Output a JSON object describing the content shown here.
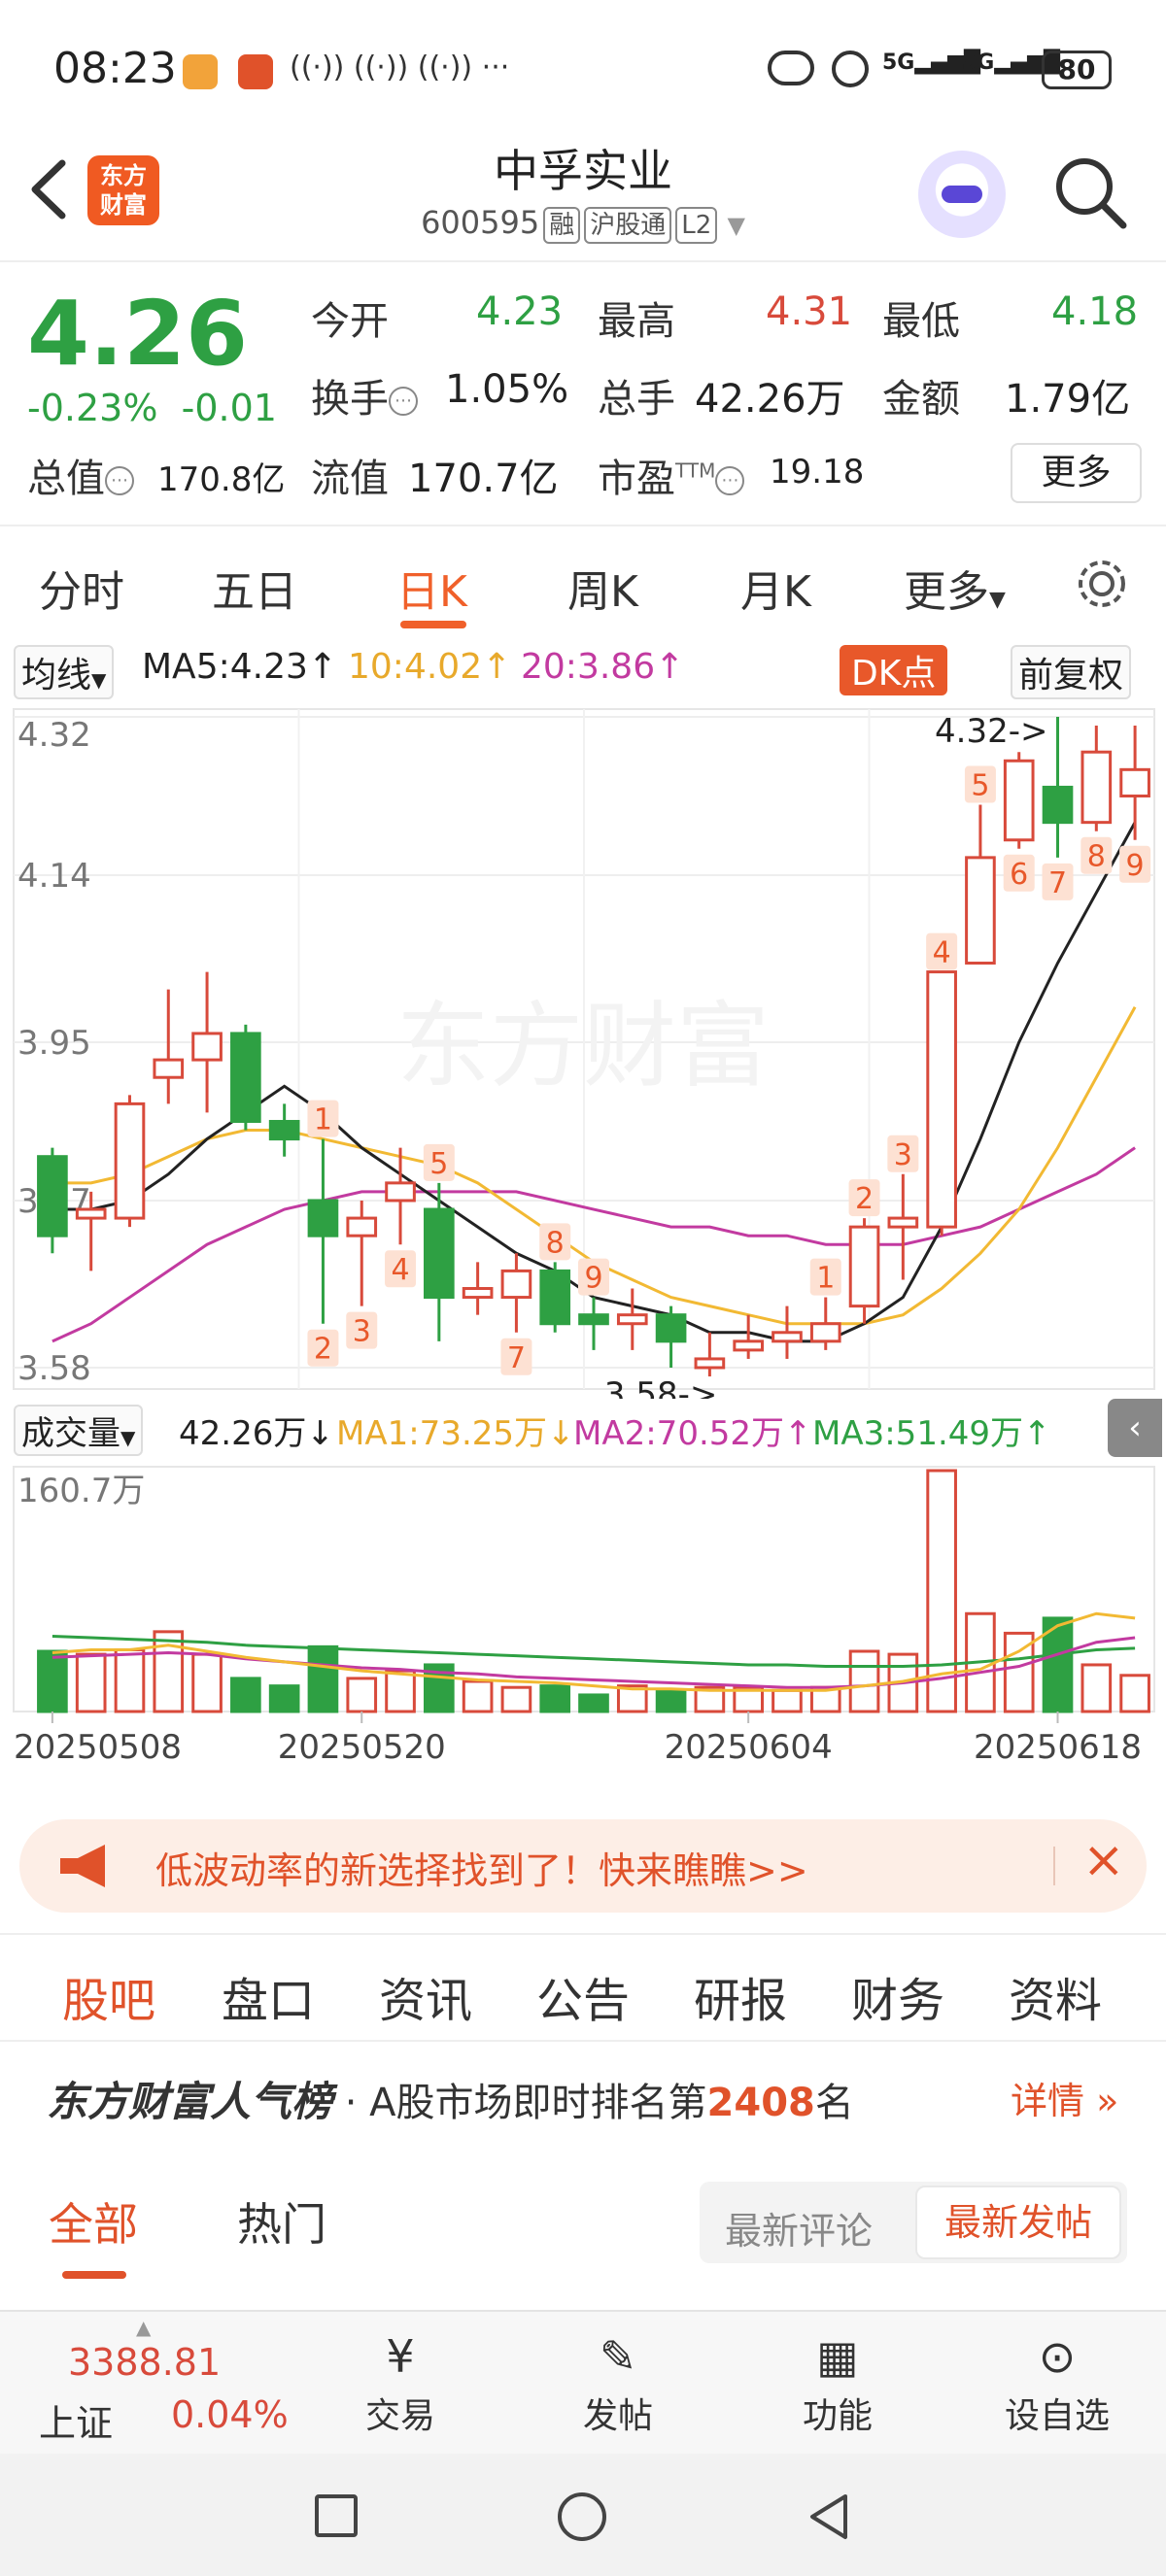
{
  "status": {
    "time": "08:23",
    "battery": "80",
    "net1": "5G",
    "net2": "5G"
  },
  "header": {
    "logo_line1": "东方",
    "logo_line2": "财富",
    "title": "中孚实业",
    "code": "600595",
    "tag1": "融",
    "tag2": "沪股通",
    "tag3": "L2"
  },
  "quote": {
    "price": "4.26",
    "change_pct": "-0.23%",
    "change": "-0.01",
    "open_label": "今开",
    "open": "4.23",
    "high_label": "最高",
    "high": "4.31",
    "low_label": "最低",
    "low": "4.18",
    "turnover_label": "换手",
    "turnover": "1.05%",
    "volume_label": "总手",
    "volume": "42.26万",
    "amount_label": "金额",
    "amount": "1.79亿",
    "mktcap_label": "总值",
    "mktcap": "170.8亿",
    "float_label": "流值",
    "float": "170.7亿",
    "pe_label": "市盈",
    "pe_sup": "TTM",
    "pe": "19.18",
    "more": "更多"
  },
  "chart_tabs": [
    "分时",
    "五日",
    "日K",
    "周K",
    "月K",
    "更多"
  ],
  "ma_bar": {
    "selector": "均线",
    "ma5": "MA5:4.23↑",
    "ma10": "10:4.02↑",
    "ma20": "20:3.86↑",
    "dk": "DK点",
    "adjust": "前复权"
  },
  "vol_bar": {
    "selector": "成交量",
    "vol": "42.26万↓",
    "ma1": "MA1:73.25万↓",
    "ma2": "MA2:70.52万↑",
    "ma3": "MA3:51.49万↑",
    "vmax": "160.7万"
  },
  "colors": {
    "up": "#d84a3b",
    "down": "#2ea043",
    "accent": "#f0602a",
    "ma5": "#222222",
    "ma10": "#f2b933",
    "ma20": "#c23aa0"
  },
  "chart_data": {
    "type": "candlestick",
    "ylim": [
      3.58,
      4.32
    ],
    "ytick_labels": [
      "4.32",
      "4.14",
      "3.95",
      "3.77",
      "3.58"
    ],
    "x_labels": [
      "20250508",
      "20250520",
      "20250604",
      "20250618"
    ],
    "max_label": "4.32->",
    "min_label": "3.58->",
    "candles": [
      {
        "o": 3.82,
        "c": 3.73,
        "h": 3.83,
        "l": 3.71
      },
      {
        "o": 3.75,
        "c": 3.76,
        "h": 3.78,
        "l": 3.69
      },
      {
        "o": 3.75,
        "c": 3.88,
        "h": 3.89,
        "l": 3.74
      },
      {
        "o": 3.91,
        "c": 3.93,
        "h": 4.01,
        "l": 3.88
      },
      {
        "o": 3.93,
        "c": 3.96,
        "h": 4.03,
        "l": 3.87
      },
      {
        "o": 3.96,
        "c": 3.86,
        "h": 3.97,
        "l": 3.85
      },
      {
        "o": 3.86,
        "c": 3.84,
        "h": 3.88,
        "l": 3.82
      },
      {
        "o": 3.77,
        "c": 3.73,
        "h": 3.84,
        "l": 3.63
      },
      {
        "o": 3.73,
        "c": 3.75,
        "h": 3.77,
        "l": 3.65
      },
      {
        "o": 3.77,
        "c": 3.79,
        "h": 3.83,
        "l": 3.72
      },
      {
        "o": 3.76,
        "c": 3.66,
        "h": 3.79,
        "l": 3.61
      },
      {
        "o": 3.66,
        "c": 3.67,
        "h": 3.7,
        "l": 3.64
      },
      {
        "o": 3.66,
        "c": 3.69,
        "h": 3.71,
        "l": 3.62
      },
      {
        "o": 3.69,
        "c": 3.63,
        "h": 3.7,
        "l": 3.62
      },
      {
        "o": 3.64,
        "c": 3.63,
        "h": 3.66,
        "l": 3.6
      },
      {
        "o": 3.63,
        "c": 3.64,
        "h": 3.67,
        "l": 3.6
      },
      {
        "o": 3.64,
        "c": 3.61,
        "h": 3.65,
        "l": 3.58
      },
      {
        "o": 3.58,
        "c": 3.59,
        "h": 3.62,
        "l": 3.57
      },
      {
        "o": 3.6,
        "c": 3.61,
        "h": 3.64,
        "l": 3.59
      },
      {
        "o": 3.61,
        "c": 3.62,
        "h": 3.65,
        "l": 3.59
      },
      {
        "o": 3.61,
        "c": 3.63,
        "h": 3.66,
        "l": 3.6
      },
      {
        "o": 3.65,
        "c": 3.74,
        "h": 3.75,
        "l": 3.63
      },
      {
        "o": 3.74,
        "c": 3.75,
        "h": 3.8,
        "l": 3.68
      },
      {
        "o": 3.74,
        "c": 4.03,
        "h": 4.03,
        "l": 3.73
      },
      {
        "o": 4.04,
        "c": 4.16,
        "h": 4.22,
        "l": 4.04
      },
      {
        "o": 4.18,
        "c": 4.27,
        "h": 4.28,
        "l": 4.17
      },
      {
        "o": 4.24,
        "c": 4.2,
        "h": 4.32,
        "l": 4.16
      },
      {
        "o": 4.2,
        "c": 4.28,
        "h": 4.31,
        "l": 4.19
      },
      {
        "o": 4.23,
        "c": 4.26,
        "h": 4.31,
        "l": 4.18
      }
    ],
    "ma5": [
      3.76,
      3.76,
      3.77,
      3.8,
      3.84,
      3.87,
      3.9,
      3.87,
      3.83,
      3.8,
      3.77,
      3.74,
      3.71,
      3.69,
      3.66,
      3.65,
      3.64,
      3.62,
      3.62,
      3.61,
      3.61,
      3.63,
      3.66,
      3.74,
      3.84,
      3.95,
      4.04,
      4.12,
      4.2
    ],
    "ma10": [
      3.79,
      3.79,
      3.8,
      3.82,
      3.84,
      3.85,
      3.85,
      3.84,
      3.83,
      3.82,
      3.81,
      3.79,
      3.76,
      3.73,
      3.7,
      3.68,
      3.66,
      3.65,
      3.64,
      3.63,
      3.63,
      3.63,
      3.64,
      3.67,
      3.71,
      3.76,
      3.83,
      3.91,
      3.99
    ],
    "ma20": [
      3.61,
      3.63,
      3.66,
      3.69,
      3.72,
      3.74,
      3.76,
      3.77,
      3.78,
      3.78,
      3.78,
      3.78,
      3.78,
      3.77,
      3.76,
      3.75,
      3.74,
      3.74,
      3.73,
      3.73,
      3.72,
      3.72,
      3.72,
      3.73,
      3.74,
      3.76,
      3.78,
      3.8,
      3.83
    ],
    "volume": [
      40,
      38,
      41,
      53,
      38,
      22,
      17,
      43,
      22,
      27,
      31,
      20,
      16,
      17,
      11,
      17,
      14,
      16,
      16,
      14,
      16,
      40,
      38,
      160,
      65,
      52,
      62,
      31,
      24
    ],
    "vol_ma1": [
      39,
      41,
      41,
      44,
      40,
      36,
      33,
      30,
      27,
      25,
      23,
      21,
      20,
      19,
      17,
      15,
      15,
      14,
      14,
      14,
      14,
      17,
      20,
      25,
      28,
      40,
      57,
      65,
      62
    ],
    "vol_ma2": [
      36,
      37,
      38,
      39,
      38,
      35,
      33,
      31,
      29,
      28,
      26,
      25,
      23,
      22,
      21,
      20,
      19,
      18,
      17,
      16,
      16,
      17,
      19,
      22,
      26,
      30,
      38,
      46,
      49
    ],
    "vol_ma3": [
      50,
      49,
      48,
      47,
      46,
      44,
      43,
      42,
      41,
      40,
      39,
      38,
      37,
      36,
      35,
      34,
      33,
      32,
      31,
      31,
      30,
      30,
      30,
      31,
      33,
      35,
      38,
      41,
      42
    ],
    "day_numbers": [
      {
        "i": 7,
        "t": "1",
        "pos": "above"
      },
      {
        "i": 7,
        "t": "2",
        "pos": "below"
      },
      {
        "i": 8,
        "t": "3",
        "pos": "below"
      },
      {
        "i": 9,
        "t": "4",
        "pos": "below"
      },
      {
        "i": 10,
        "t": "5",
        "pos": "above"
      },
      {
        "i": 12,
        "t": "7",
        "pos": "below"
      },
      {
        "i": 13,
        "t": "8",
        "pos": "above"
      },
      {
        "i": 14,
        "t": "9",
        "pos": "above"
      },
      {
        "i": 20,
        "t": "1",
        "pos": "above"
      },
      {
        "i": 21,
        "t": "2",
        "pos": "above"
      },
      {
        "i": 22,
        "t": "3",
        "pos": "above"
      },
      {
        "i": 23,
        "t": "4",
        "pos": "above"
      },
      {
        "i": 24,
        "t": "5",
        "pos": "above"
      },
      {
        "i": 25,
        "t": "6",
        "pos": "below"
      },
      {
        "i": 26,
        "t": "7",
        "pos": "below"
      },
      {
        "i": 27,
        "t": "8",
        "pos": "below"
      },
      {
        "i": 28,
        "t": "9",
        "pos": "below"
      }
    ]
  },
  "banner": {
    "text": "低波动率的新选择找到了！快来瞧瞧>>"
  },
  "feature_tabs": [
    "股吧",
    "盘口",
    "资讯",
    "公告",
    "研报",
    "财务",
    "资料"
  ],
  "rank": {
    "brand": "东方财富人气榜",
    "text": "· A股市场即时排名第",
    "rank": "2408",
    "suffix": "名",
    "detail": "详情"
  },
  "sub_tabs": {
    "all": "全部",
    "hot": "热门",
    "latest_comment": "最新评论",
    "latest_post": "最新发帖"
  },
  "bottom": {
    "index_value": "3388.81",
    "index_name": "上证",
    "index_change": "0.04%",
    "trade": "交易",
    "post": "发帖",
    "func": "功能",
    "watch": "设自选"
  }
}
